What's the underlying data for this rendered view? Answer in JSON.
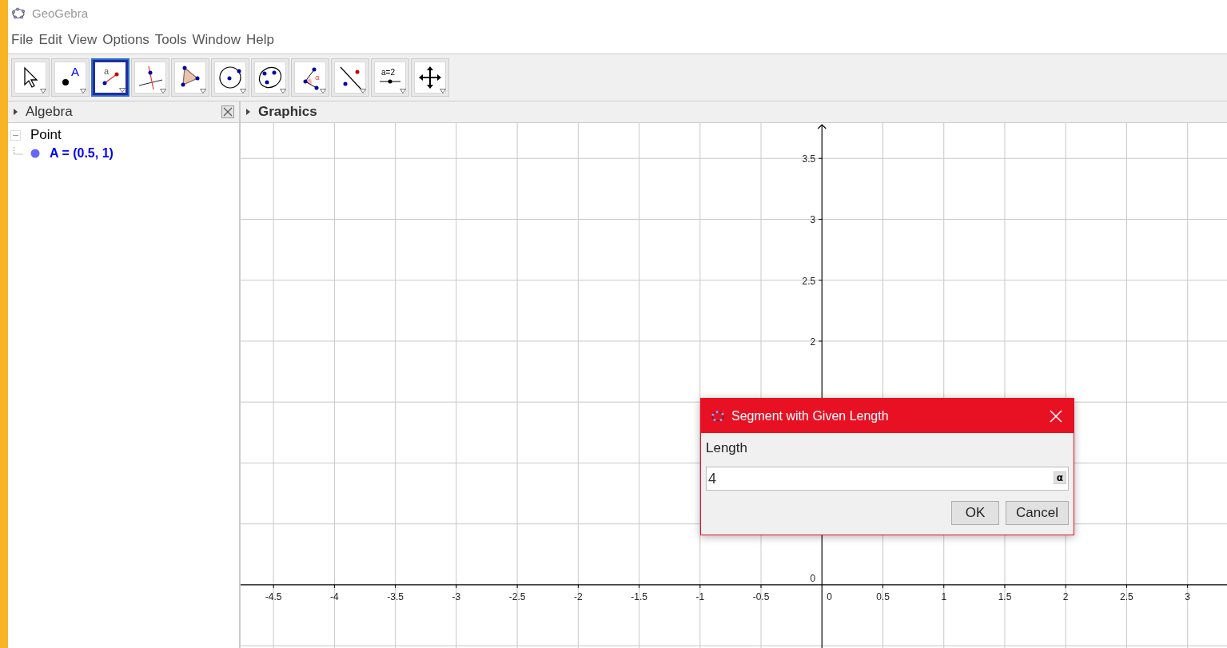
{
  "window": {
    "title": "GeoGebra"
  },
  "menu": [
    "File",
    "Edit",
    "View",
    "Options",
    "Tools",
    "Window",
    "Help"
  ],
  "toolbar": [
    {
      "kind": "move",
      "selected": false
    },
    {
      "kind": "point",
      "selected": false,
      "glyph": "A"
    },
    {
      "kind": "segment",
      "selected": true,
      "glyph": "a"
    },
    {
      "kind": "perpendicular",
      "selected": false
    },
    {
      "kind": "polygon",
      "selected": false
    },
    {
      "kind": "circle",
      "selected": false
    },
    {
      "kind": "conic",
      "selected": false
    },
    {
      "kind": "angle",
      "selected": false,
      "glyph": "α"
    },
    {
      "kind": "reflect",
      "selected": false
    },
    {
      "kind": "slider",
      "selected": false,
      "glyph": "a=2"
    },
    {
      "kind": "pan",
      "selected": false
    }
  ],
  "algebra": {
    "title": "Algebra",
    "tree": [
      {
        "label": "Point",
        "expanded": true,
        "children": [
          {
            "label": "A = (0.5, 1)"
          }
        ]
      }
    ]
  },
  "graphics": {
    "title": "Graphics",
    "origin_label": "0",
    "chart_data": {
      "type": "scatter",
      "grid": true,
      "xlim": [
        -4.77,
        3.33
      ],
      "ylim": [
        -0.525,
        3.79
      ],
      "xticks": [
        {
          "value": -4.5,
          "label": "-4.5"
        },
        {
          "value": -4,
          "label": "-4"
        },
        {
          "value": -3.5,
          "label": "-3.5"
        },
        {
          "value": -3,
          "label": "-3"
        },
        {
          "value": -2.5,
          "label": "-2.5"
        },
        {
          "value": -2,
          "label": "-2"
        },
        {
          "value": -1.5,
          "label": "-1.5"
        },
        {
          "value": -1,
          "label": "-1"
        },
        {
          "value": -0.5,
          "label": "-0.5"
        },
        {
          "value": 0.5,
          "label": "0.5"
        },
        {
          "value": 1,
          "label": "1"
        },
        {
          "value": 1.5,
          "label": "1.5"
        },
        {
          "value": 2,
          "label": "2"
        },
        {
          "value": 2.5,
          "label": "2.5"
        },
        {
          "value": 3,
          "label": "3"
        }
      ],
      "yticks": [
        {
          "value": 3.5,
          "label": "3.5"
        },
        {
          "value": 3,
          "label": "3"
        },
        {
          "value": 2.5,
          "label": "2.5"
        },
        {
          "value": 2,
          "label": "2"
        },
        {
          "value": 0,
          "label": "0"
        }
      ]
    }
  },
  "dialog": {
    "title": "Segment with Given Length",
    "field_label": "Length",
    "value": "4",
    "symbol_button": "α",
    "buttons": [
      "OK",
      "Cancel"
    ]
  }
}
